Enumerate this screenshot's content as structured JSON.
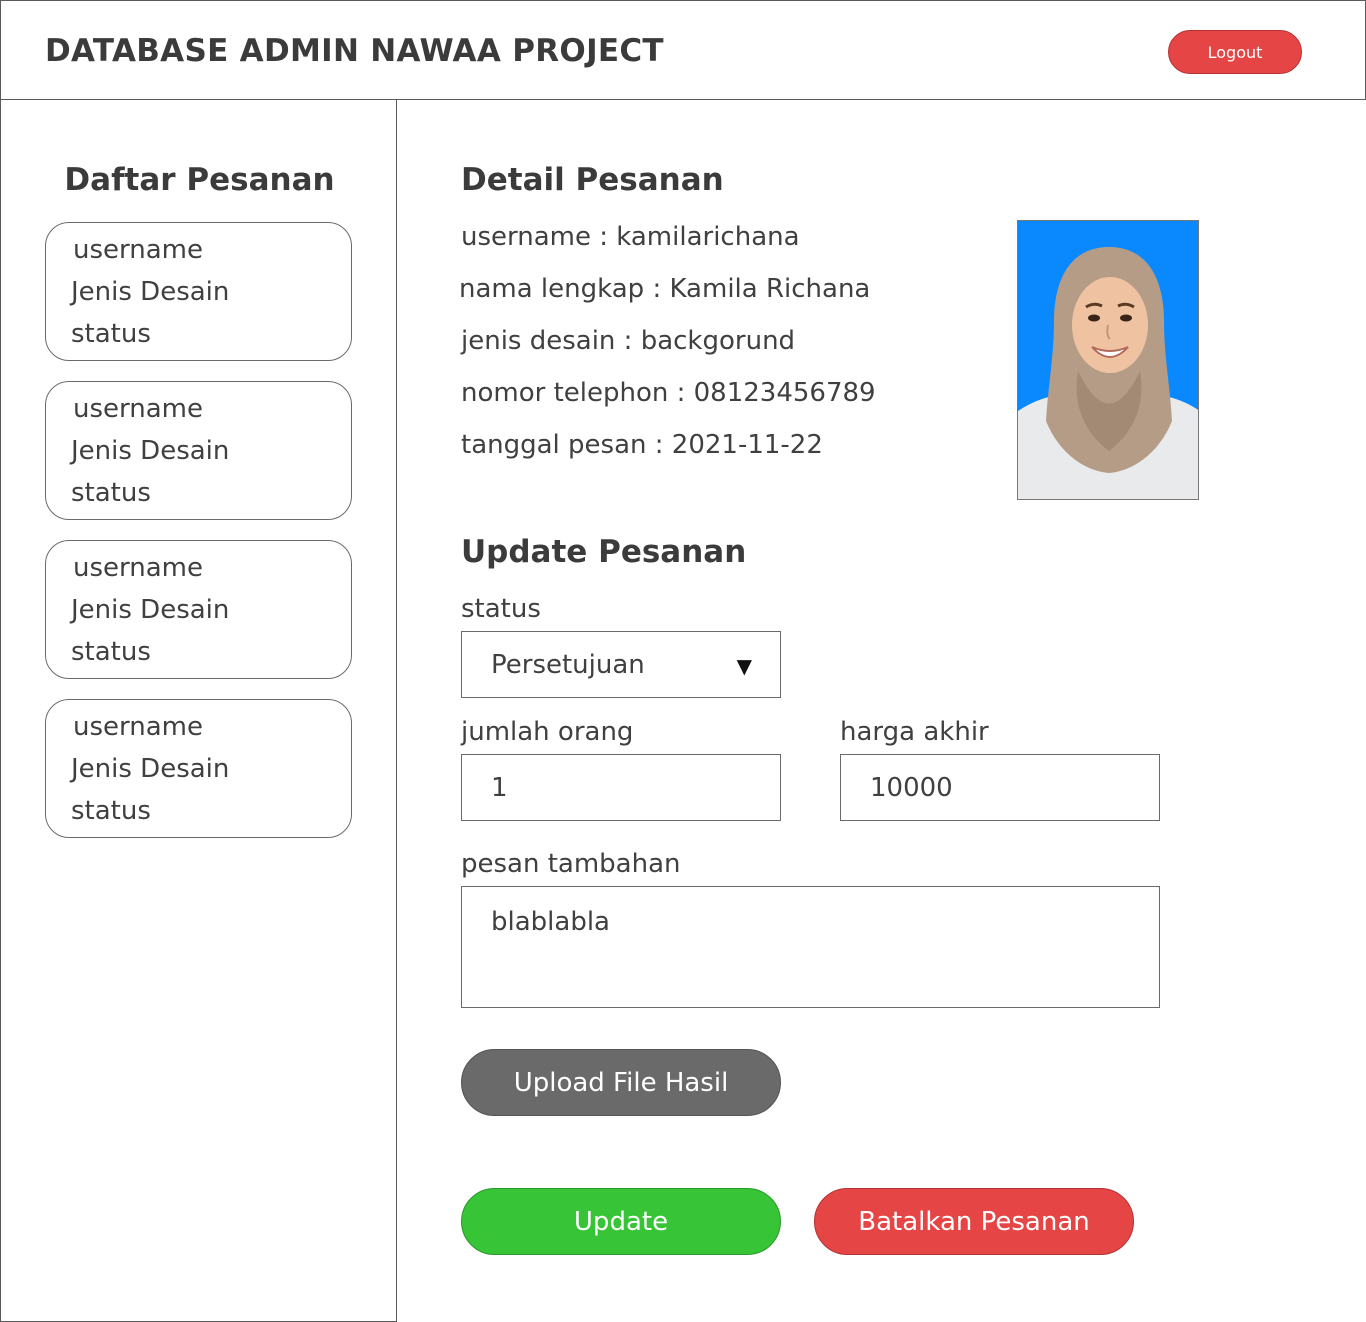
{
  "header": {
    "title": "DATABASE ADMIN NAWAA PROJECT",
    "logout_label": "Logout"
  },
  "sidebar": {
    "title": "Daftar Pesanan",
    "orders": [
      {
        "username": "username",
        "jenis_desain": "Jenis Desain",
        "status": "status"
      },
      {
        "username": "username",
        "jenis_desain": "Jenis Desain",
        "status": "status"
      },
      {
        "username": "username",
        "jenis_desain": "Jenis Desain",
        "status": "status"
      },
      {
        "username": "username",
        "jenis_desain": "Jenis Desain",
        "status": "status"
      }
    ]
  },
  "detail": {
    "title": "Detail Pesanan",
    "username": "username : kamilarichana",
    "nama_lengkap": "nama lengkap : Kamila Richana",
    "jenis_desain": "jenis desain : backgorund",
    "nomor_telephon": "nomor telephon : 08123456789",
    "tanggal_pesan": "tanggal pesan : 2021-11-22"
  },
  "update": {
    "title": "Update Pesanan",
    "status_label": "status",
    "status_value": "Persetujuan",
    "jumlah_orang_label": "jumlah orang",
    "jumlah_orang_value": "1",
    "harga_akhir_label": "harga akhir",
    "harga_akhir_value": "10000",
    "pesan_tambahan_label": "pesan tambahan",
    "pesan_tambahan_value": "blablabla",
    "upload_label": "Upload File Hasil",
    "update_label": "Update",
    "cancel_label": "Batalkan Pesanan"
  },
  "colors": {
    "logout": "#e64545",
    "upload": "#6a6a6a",
    "update": "#37c437",
    "cancel": "#e64545",
    "photo_background": "#0a89ff"
  }
}
